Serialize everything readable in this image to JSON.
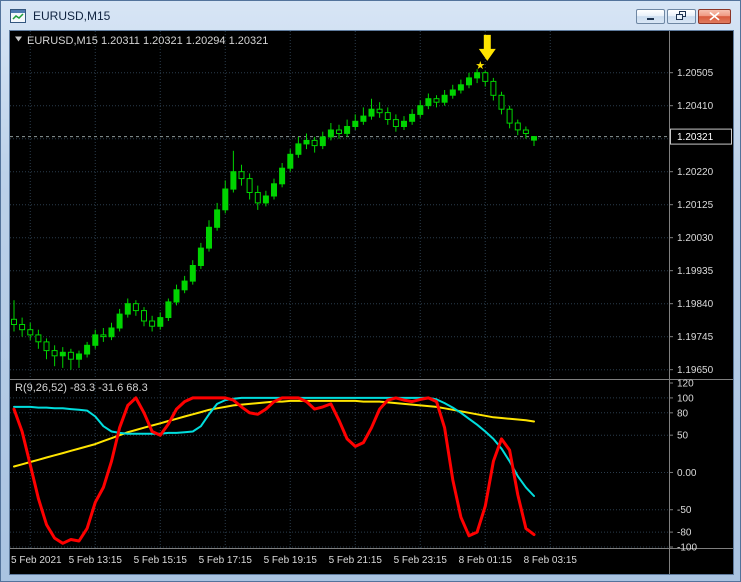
{
  "window": {
    "title": "EURUSD,M15",
    "control_icons": [
      "minimize",
      "restore-down",
      "close"
    ]
  },
  "colors": {
    "background": "#000000",
    "grid": "#2b3c4c",
    "axis_text": "#dadada",
    "label_text": "#d4d4d4",
    "candle": "#00d400",
    "separator": "#7f7f7f",
    "signal": "#ffe400"
  },
  "chart_data": {
    "type": "candlestick",
    "symbol": "EURUSD",
    "timeframe": "M15",
    "symbol_label": "EURUSD,M15  1.20311 1.20321 1.20294 1.20321",
    "last_candle_ohlc": {
      "open": 1.20311,
      "high": 1.20321,
      "low": 1.20294,
      "close": 1.20321
    },
    "price_axis": {
      "ylim": [
        1.19626,
        1.20625
      ],
      "gridline_values": [
        1.20505,
        1.2041,
        1.20315,
        1.2022,
        1.20125,
        1.2003,
        1.19935,
        1.1984,
        1.19745,
        1.1965
      ],
      "current_price": 1.20321,
      "current_price_label": "1.20321"
    },
    "time_axis": {
      "labels": [
        "5 Feb 2021",
        "5 Feb 13:15",
        "5 Feb 15:15",
        "5 Feb 17:15",
        "5 Feb 19:15",
        "5 Feb 21:15",
        "5 Feb 23:15",
        "8 Feb 01:15",
        "8 Feb 03:15"
      ],
      "first_label_candle_index": 2,
      "candles_per_label": 8
    },
    "candles": [
      [
        1.19795,
        1.1985,
        1.1976,
        1.1978
      ],
      [
        1.1978,
        1.198,
        1.19745,
        1.19765
      ],
      [
        1.19765,
        1.19785,
        1.19735,
        1.1975
      ],
      [
        1.1975,
        1.19765,
        1.1971,
        1.1973
      ],
      [
        1.1973,
        1.1974,
        1.1968,
        1.19705
      ],
      [
        1.19705,
        1.1972,
        1.1966,
        1.1969
      ],
      [
        1.1969,
        1.19715,
        1.19655,
        1.197
      ],
      [
        1.197,
        1.1971,
        1.1965,
        1.1968
      ],
      [
        1.1968,
        1.19705,
        1.19655,
        1.19695
      ],
      [
        1.19695,
        1.1973,
        1.19685,
        1.1972
      ],
      [
        1.1972,
        1.19765,
        1.1971,
        1.1975
      ],
      [
        1.1975,
        1.1977,
        1.1973,
        1.19745
      ],
      [
        1.19745,
        1.19785,
        1.19735,
        1.1977
      ],
      [
        1.1977,
        1.19825,
        1.1976,
        1.1981
      ],
      [
        1.1981,
        1.19855,
        1.198,
        1.1984
      ],
      [
        1.1984,
        1.1985,
        1.19805,
        1.1982
      ],
      [
        1.1982,
        1.1983,
        1.19775,
        1.1979
      ],
      [
        1.1979,
        1.19805,
        1.1976,
        1.19775
      ],
      [
        1.19775,
        1.19815,
        1.19765,
        1.198
      ],
      [
        1.198,
        1.19855,
        1.1979,
        1.19845
      ],
      [
        1.19845,
        1.19895,
        1.19835,
        1.1988
      ],
      [
        1.1988,
        1.1992,
        1.1987,
        1.19905
      ],
      [
        1.19905,
        1.19965,
        1.19895,
        1.1995
      ],
      [
        1.1995,
        1.20015,
        1.1994,
        1.2
      ],
      [
        1.2,
        1.2008,
        1.1999,
        1.2006
      ],
      [
        1.2006,
        1.2013,
        1.2005,
        1.2011
      ],
      [
        1.2011,
        1.20195,
        1.201,
        1.2017
      ],
      [
        1.2017,
        1.2028,
        1.2016,
        1.2022
      ],
      [
        1.2022,
        1.2024,
        1.2018,
        1.202
      ],
      [
        1.202,
        1.20215,
        1.2014,
        1.2016
      ],
      [
        1.2016,
        1.2018,
        1.2011,
        1.2013
      ],
      [
        1.2013,
        1.20165,
        1.2012,
        1.2015
      ],
      [
        1.2015,
        1.202,
        1.2014,
        1.20185
      ],
      [
        1.20185,
        1.20245,
        1.20175,
        1.2023
      ],
      [
        1.2023,
        1.20285,
        1.2022,
        1.2027
      ],
      [
        1.2027,
        1.2032,
        1.2026,
        1.203
      ],
      [
        1.203,
        1.2033,
        1.20285,
        1.2031
      ],
      [
        1.2031,
        1.2032,
        1.20275,
        1.20295
      ],
      [
        1.20295,
        1.20335,
        1.20285,
        1.2032
      ],
      [
        1.2032,
        1.2036,
        1.2031,
        1.2034
      ],
      [
        1.2034,
        1.20355,
        1.20315,
        1.2033
      ],
      [
        1.2033,
        1.2037,
        1.2032,
        1.2035
      ],
      [
        1.2035,
        1.20385,
        1.2034,
        1.20365
      ],
      [
        1.20365,
        1.20405,
        1.20355,
        1.2038
      ],
      [
        1.2038,
        1.2043,
        1.2037,
        1.204
      ],
      [
        1.204,
        1.2042,
        1.20375,
        1.2039
      ],
      [
        1.2039,
        1.20405,
        1.20355,
        1.2037
      ],
      [
        1.2037,
        1.20385,
        1.20335,
        1.2035
      ],
      [
        1.2035,
        1.2038,
        1.2034,
        1.20365
      ],
      [
        1.20365,
        1.204,
        1.20355,
        1.20385
      ],
      [
        1.20385,
        1.20425,
        1.20375,
        1.2041
      ],
      [
        1.2041,
        1.20445,
        1.204,
        1.2043
      ],
      [
        1.2043,
        1.2044,
        1.20405,
        1.2042
      ],
      [
        1.2042,
        1.20455,
        1.2041,
        1.2044
      ],
      [
        1.2044,
        1.2047,
        1.2043,
        1.20455
      ],
      [
        1.20455,
        1.20485,
        1.20445,
        1.2047
      ],
      [
        1.2047,
        1.20505,
        1.2046,
        1.2049
      ],
      [
        1.2049,
        1.20515,
        1.20475,
        1.20505
      ],
      [
        1.20505,
        1.2051,
        1.20465,
        1.2048
      ],
      [
        1.2048,
        1.2049,
        1.20425,
        1.2044
      ],
      [
        1.2044,
        1.2045,
        1.20385,
        1.204
      ],
      [
        1.204,
        1.2041,
        1.20345,
        1.2036
      ],
      [
        1.2036,
        1.2037,
        1.20325,
        1.2034
      ],
      [
        1.2034,
        1.2035,
        1.20315,
        1.2033
      ],
      [
        1.20311,
        1.20321,
        1.20294,
        1.20321
      ]
    ],
    "oscillator": {
      "label": "R(9,26,52) -83.3 -31.6 68.3",
      "ylim": [
        -100,
        120
      ],
      "levels": [
        120,
        100,
        80,
        50,
        0,
        -50,
        -80,
        -100
      ],
      "level_labels": [
        "120",
        "100",
        "80",
        "50",
        "0.00",
        "-50",
        "-80",
        "-100"
      ],
      "series": [
        {
          "name": "slow-period-52",
          "color": "#ffe400",
          "width": 2,
          "values": [
            8,
            11,
            14,
            17,
            20,
            23,
            26,
            29,
            32,
            35,
            38,
            42,
            46,
            50,
            54,
            57,
            60,
            63,
            66,
            69,
            72,
            75,
            78,
            81,
            84,
            86,
            88,
            90,
            91,
            92,
            93,
            94,
            95,
            95,
            96,
            96,
            96,
            96,
            96,
            96,
            96,
            96,
            96,
            95,
            95,
            95,
            94,
            93,
            92,
            91,
            90,
            89,
            88,
            86,
            84,
            82,
            80,
            78,
            76,
            74,
            73,
            72,
            71,
            70,
            68.3
          ]
        },
        {
          "name": "medium-period-26",
          "color": "#00dddd",
          "width": 2,
          "values": [
            88,
            88,
            88,
            87,
            87,
            86,
            86,
            85,
            84,
            83,
            75,
            62,
            55,
            53,
            52,
            52,
            52,
            52,
            52,
            53,
            53,
            54,
            55,
            62,
            78,
            92,
            97,
            99,
            100,
            100,
            100,
            100,
            100,
            100,
            100,
            100,
            100,
            100,
            100,
            100,
            100,
            100,
            100,
            100,
            100,
            100,
            100,
            100,
            100,
            100,
            100,
            100,
            98,
            93,
            87,
            80,
            72,
            64,
            55,
            45,
            32,
            15,
            -5,
            -20,
            -31.6
          ]
        },
        {
          "name": "fast-period-9",
          "color": "#ff0000",
          "width": 3,
          "values": [
            85,
            55,
            10,
            -35,
            -70,
            -88,
            -95,
            -90,
            -92,
            -75,
            -40,
            -20,
            15,
            60,
            90,
            100,
            80,
            55,
            50,
            65,
            85,
            95,
            100,
            100,
            100,
            100,
            100,
            97,
            88,
            80,
            78,
            85,
            95,
            100,
            100,
            100,
            95,
            85,
            88,
            92,
            70,
            45,
            35,
            40,
            60,
            85,
            97,
            100,
            97,
            95,
            98,
            100,
            95,
            60,
            -10,
            -60,
            -85,
            -80,
            -45,
            15,
            45,
            30,
            -30,
            -75,
            -83.3
          ]
        }
      ]
    },
    "annotations": [
      {
        "type": "arrow-down",
        "candle_index": 58,
        "color": "#ffe400"
      },
      {
        "type": "star",
        "candle_index": 58,
        "color": "#ffe400"
      }
    ]
  }
}
